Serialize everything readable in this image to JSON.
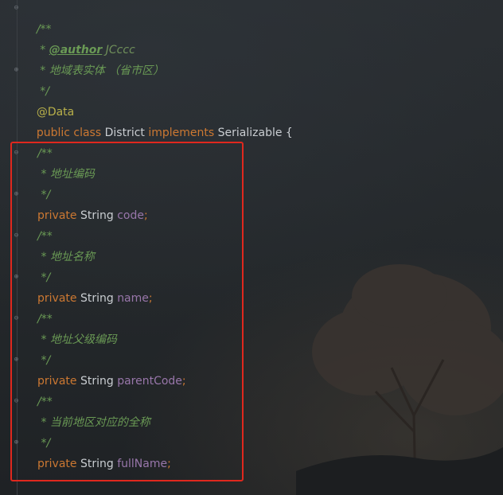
{
  "editor": {
    "header_comment": {
      "open": "/**",
      "author_prefix": " * ",
      "author_tag": "@author",
      "author_name": " JCccc",
      "desc": " * 地域表实体 （省市区）",
      "close": " */"
    },
    "annotation": "@Data",
    "class_decl": {
      "kw_public": "public",
      "kw_class": "class",
      "name": "District",
      "kw_implements": "implements",
      "iface": "Serializable",
      "brace": "{"
    },
    "fields": [
      {
        "comment_open": "/**",
        "comment_text": " * 地址编码",
        "comment_close": " */",
        "modifier": "private",
        "type": "String",
        "name": "code",
        "semi": ";"
      },
      {
        "comment_open": "/**",
        "comment_text": " * 地址名称",
        "comment_close": " */",
        "modifier": "private",
        "type": "String",
        "name": "name",
        "semi": ";"
      },
      {
        "comment_open": "/**",
        "comment_text": " * 地址父级编码",
        "comment_close": " */",
        "modifier": "private",
        "type": "String",
        "name": "parentCode",
        "semi": ";"
      },
      {
        "comment_open": "/**",
        "comment_text": " * 当前地区对应的全称",
        "comment_close": " */",
        "modifier": "private",
        "type": "String",
        "name": "fullName",
        "semi": ";"
      }
    ],
    "highlight_color": "#e0281e"
  }
}
